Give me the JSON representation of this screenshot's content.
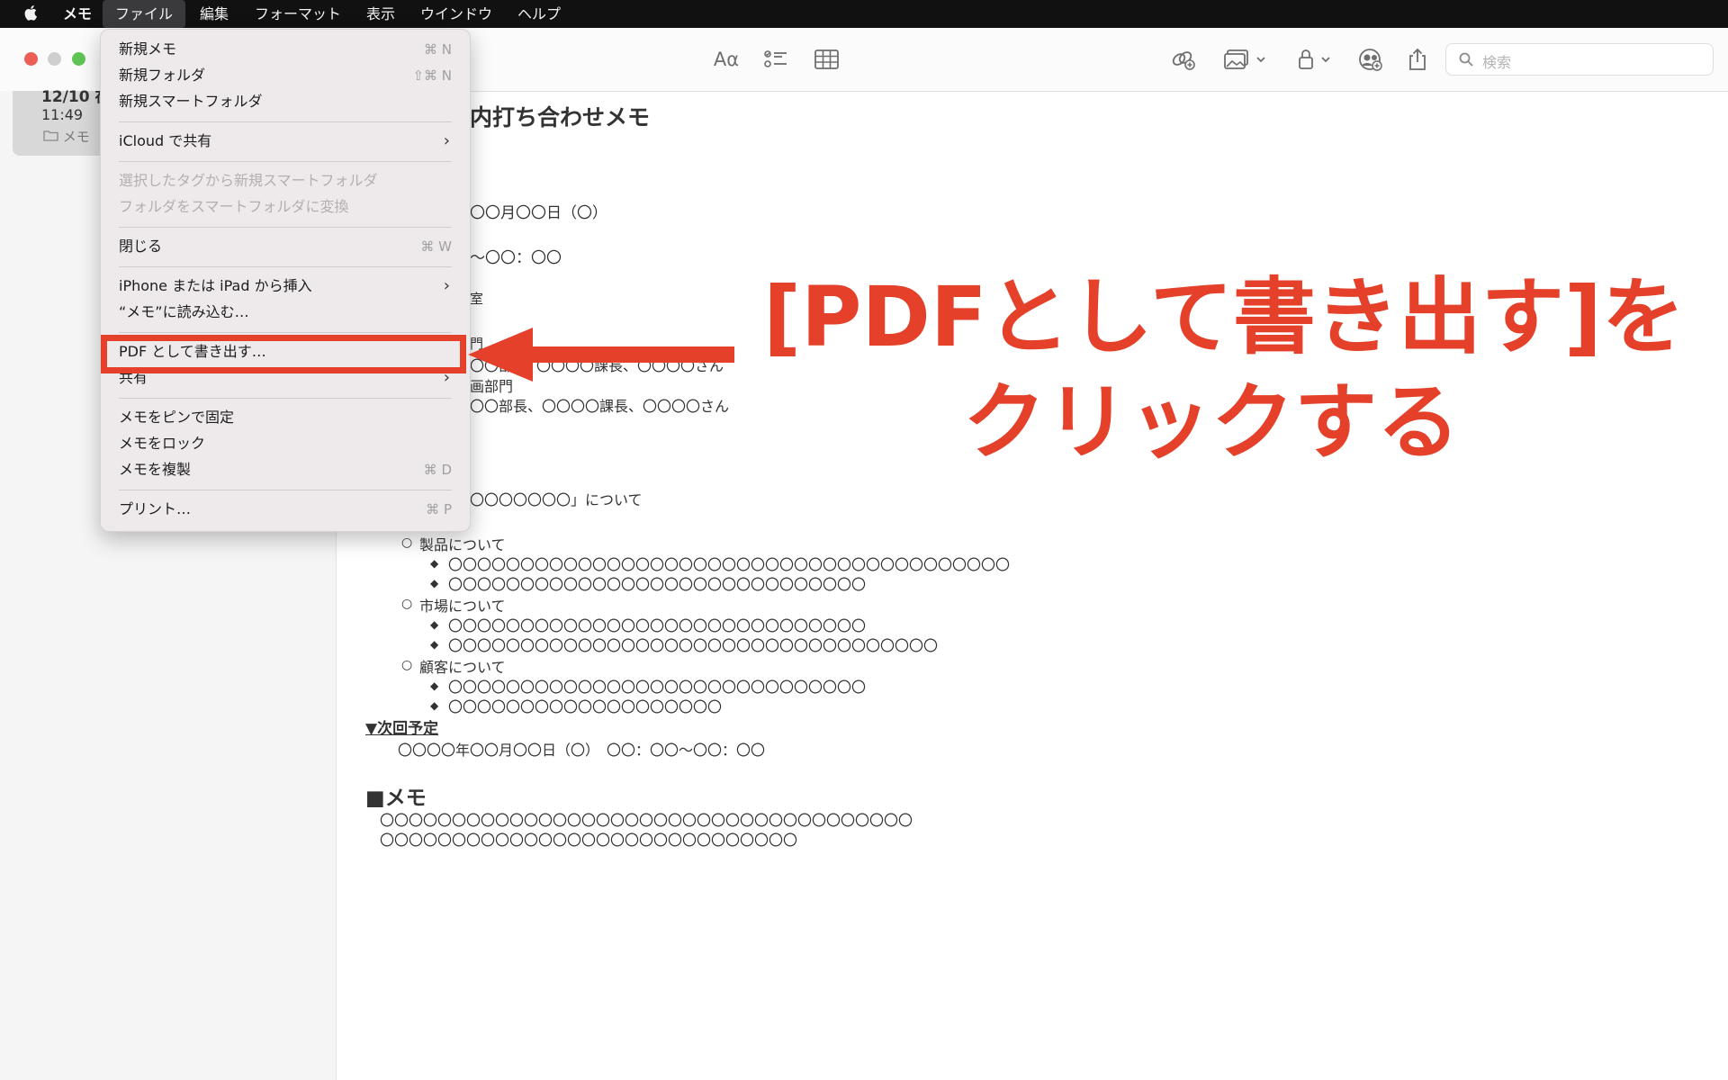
{
  "menubar": {
    "app_name": "メモ",
    "items": [
      "ファイル",
      "編集",
      "フォーマット",
      "表示",
      "ウインドウ",
      "ヘルプ"
    ]
  },
  "toolbar": {
    "format_label": "Aα",
    "search_placeholder": "検索"
  },
  "sidebar": {
    "note_date": "12/10 在",
    "note_time": "11:49",
    "note_folder": "メモ"
  },
  "note": {
    "title": "内打ち合わせメモ",
    "lines": [
      "〇〇月〇〇日（〇）",
      "〜〇〇：〇〇",
      "室",
      "門",
      "〇〇部",
      "〇〇〇〇課長、〇〇〇〇さん",
      "画部門",
      "〇〇部長、〇〇〇〇課長、〇〇〇〇さん",
      "〇〇〇〇〇〇〇」について"
    ],
    "topics": [
      {
        "heading": "製品について",
        "items": [
          "〇〇〇〇〇〇〇〇〇〇〇〇〇〇〇〇〇〇〇〇〇〇〇〇〇〇〇〇〇〇〇〇〇〇〇〇〇〇〇",
          "〇〇〇〇〇〇〇〇〇〇〇〇〇〇〇〇〇〇〇〇〇〇〇〇〇〇〇〇〇"
        ]
      },
      {
        "heading": "市場について",
        "items": [
          "〇〇〇〇〇〇〇〇〇〇〇〇〇〇〇〇〇〇〇〇〇〇〇〇〇〇〇〇〇",
          "〇〇〇〇〇〇〇〇〇〇〇〇〇〇〇〇〇〇〇〇〇〇〇〇〇〇〇〇〇〇〇〇〇〇"
        ]
      },
      {
        "heading": "顧客について",
        "items": [
          "〇〇〇〇〇〇〇〇〇〇〇〇〇〇〇〇〇〇〇〇〇〇〇〇〇〇〇〇〇",
          "〇〇〇〇〇〇〇〇〇〇〇〇〇〇〇〇〇〇〇"
        ]
      }
    ],
    "next_heading": "▼次回予定",
    "next_date": "〇〇〇〇年〇〇月〇〇日（〇）　〇〇：〇〇〜〇〇：〇〇",
    "memo_heading": "■メモ",
    "memo_lines": [
      "〇〇〇〇〇〇〇〇〇〇〇〇〇〇〇〇〇〇〇〇〇〇〇〇〇〇〇〇〇〇〇〇〇〇〇〇〇",
      "〇〇〇〇〇〇〇〇〇〇〇〇〇〇〇〇〇〇〇〇〇〇〇〇〇〇〇〇〇"
    ]
  },
  "file_menu": {
    "new_note": "新規メモ",
    "new_note_sc": "⌘ N",
    "new_folder": "新規フォルダ",
    "new_folder_sc": "⇧⌘ N",
    "new_smart_folder": "新規スマートフォルダ",
    "share_icloud": "iCloud で共有",
    "smart_from_tag": "選択したタグから新規スマートフォルダ",
    "convert_smart": "フォルダをスマートフォルダに変換",
    "close": "閉じる",
    "close_sc": "⌘ W",
    "insert_iphone": "iPhone または iPad から挿入",
    "import_notes": "“メモ”に読み込む…",
    "export_pdf": "PDF として書き出す…",
    "share": "共有",
    "pin": "メモをピンで固定",
    "lock": "メモをロック",
    "duplicate": "メモを複製",
    "duplicate_sc": "⌘ D",
    "print": "プリント…",
    "print_sc": "⌘ P"
  },
  "annotation": {
    "line1": "[PDFとして書き出す]を",
    "line2": "クリックする",
    "color": "#e4402a"
  }
}
